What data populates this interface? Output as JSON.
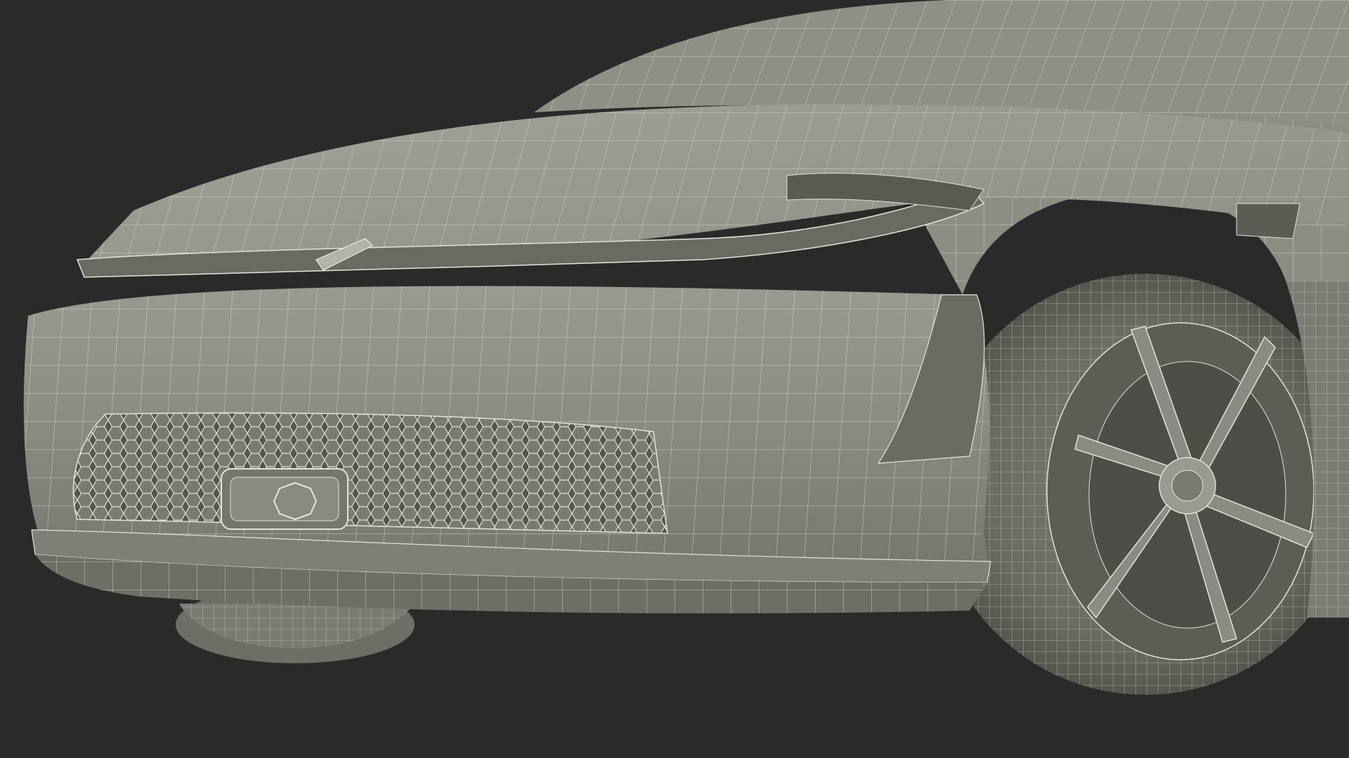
{
  "scene": {
    "subject": "car-front-wireframe",
    "colors": {
      "background": "#2a2a2a",
      "surface": "#8c8c83",
      "surface_dark": "#5c5c55",
      "surface_light": "#a3a39a",
      "wire": "#e8e8dc",
      "wire_soft": "#c9c9bd",
      "shadow": "#3c3c38"
    }
  }
}
